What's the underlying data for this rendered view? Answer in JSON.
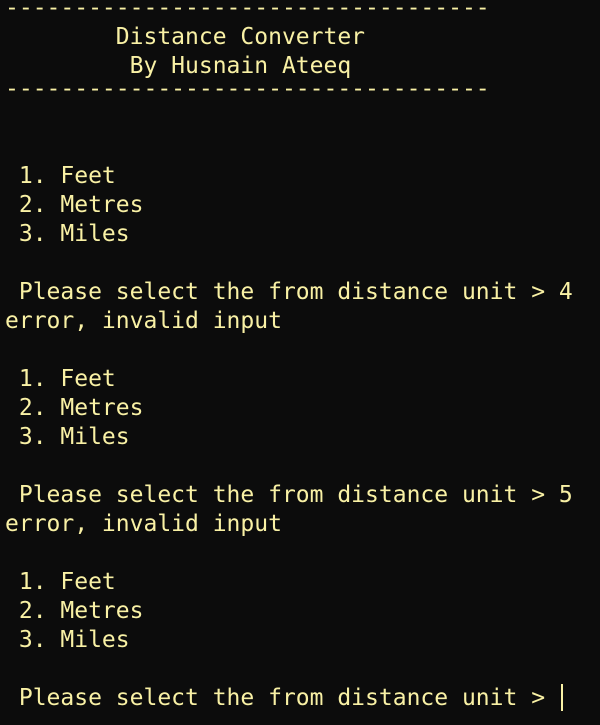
{
  "header": {
    "divider_top": "-----------------------------------",
    "title": "        Distance Converter",
    "author": "         By Husnain Ateeq",
    "divider_bottom": "-----------------------------------"
  },
  "menu": [
    " 1. Feet",
    " 2. Metres",
    " 3. Miles"
  ],
  "attempts": [
    {
      "prompt": " Please select the from distance unit > 4",
      "error": "error, invalid input"
    },
    {
      "prompt": " Please select the from distance unit > 5",
      "error": "error, invalid input"
    }
  ],
  "current_prompt": " Please select the from distance unit > "
}
